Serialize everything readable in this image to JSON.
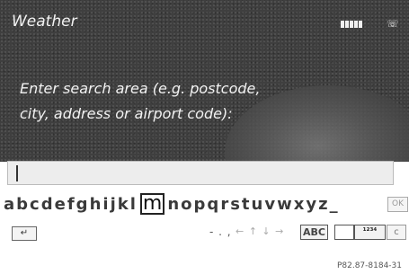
{
  "header": {
    "title": "Weather"
  },
  "prompt": {
    "line1": "Enter search area (e.g. postcode,",
    "line2": "city, address or airport code):"
  },
  "keyboard": {
    "letters": [
      "a",
      "b",
      "c",
      "d",
      "e",
      "f",
      "g",
      "h",
      "i",
      "j",
      "k",
      "l",
      "m",
      "n",
      "o",
      "p",
      "q",
      "r",
      "s",
      "t",
      "u",
      "v",
      "w",
      "x",
      "y",
      "z",
      "_"
    ],
    "selected_letter": "m",
    "ok_label": "OK",
    "back_symbol": "↵",
    "punctuation": "- . ,",
    "arrows": "← ↑ ↓ →",
    "abc_label": "ABC",
    "digits_label": "¹²³⁴",
    "clear_label": "c"
  },
  "icons": {
    "signal": "signal-strength-icon",
    "phone": "phone-icon",
    "back": "back-icon"
  },
  "footer": {
    "ref_code": "P82.87-8184-31"
  },
  "colors": {
    "screen_bg": "#3f3f3f",
    "text_light": "#f2f2f2"
  }
}
